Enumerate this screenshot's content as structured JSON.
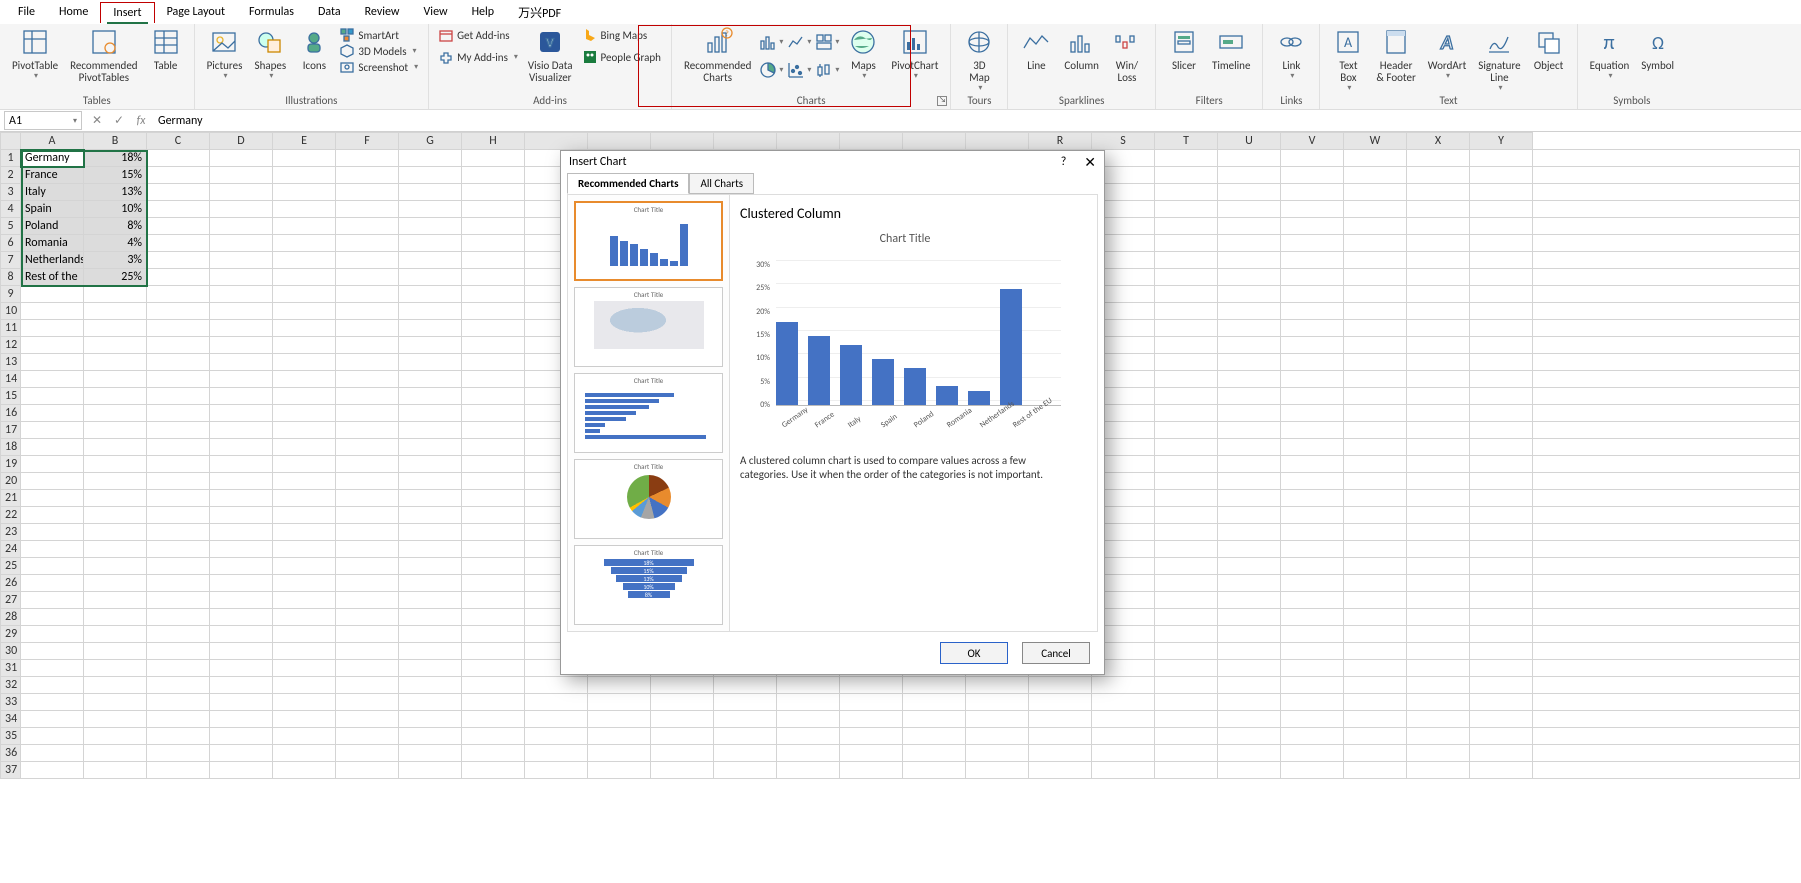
{
  "menu": {
    "tabs": [
      "File",
      "Home",
      "Insert",
      "Page Layout",
      "Formulas",
      "Data",
      "Review",
      "View",
      "Help",
      "万兴PDF"
    ],
    "active": "Insert"
  },
  "ribbon": {
    "tables": {
      "label": "Tables",
      "pivot": "PivotTable",
      "recpivot": "Recommended\nPivotTables",
      "table": "Table"
    },
    "illus": {
      "label": "Illustrations",
      "pictures": "Pictures",
      "shapes": "Shapes",
      "icons": "Icons",
      "smartart": "SmartArt",
      "models": "3D Models",
      "screenshot": "Screenshot"
    },
    "addins": {
      "label": "Add-ins",
      "get": "Get Add-ins",
      "my": "My Add-ins",
      "visio": "Visio Data\nVisualizer",
      "bing": "Bing Maps",
      "people": "People Graph"
    },
    "charts": {
      "label": "Charts",
      "rec": "Recommended\nCharts",
      "maps": "Maps",
      "pivotchart": "PivotChart"
    },
    "tours": {
      "label": "Tours",
      "map3d": "3D\nMap"
    },
    "spark": {
      "label": "Sparklines",
      "line": "Line",
      "column": "Column",
      "winloss": "Win/\nLoss"
    },
    "filters": {
      "label": "Filters",
      "slicer": "Slicer",
      "timeline": "Timeline"
    },
    "links": {
      "label": "Links",
      "link": "Link"
    },
    "text": {
      "label": "Text",
      "textbox": "Text\nBox",
      "header": "Header\n& Footer",
      "wordart": "WordArt",
      "sig": "Signature\nLine",
      "obj": "Object"
    },
    "symbols": {
      "label": "Symbols",
      "eq": "Equation",
      "sym": "Symbol"
    }
  },
  "formula_bar": {
    "cell_ref": "A1",
    "value": "Germany"
  },
  "columns": [
    "A",
    "B",
    "C",
    "D",
    "E",
    "F",
    "G",
    "H",
    "",
    "",
    "",
    "",
    "",
    "",
    "",
    "",
    "",
    "R",
    "S",
    "T",
    "U",
    "V",
    "W",
    "X",
    "Y"
  ],
  "cells": [
    {
      "country": "Germany",
      "pct": "18%"
    },
    {
      "country": "France",
      "pct": "15%"
    },
    {
      "country": "Italy",
      "pct": "13%"
    },
    {
      "country": "Spain",
      "pct": "10%"
    },
    {
      "country": "Poland",
      "pct": "8%"
    },
    {
      "country": "Romania",
      "pct": "4%"
    },
    {
      "country": "Netherlands",
      "pct": "3%"
    },
    {
      "country": "Rest of the",
      "pct": "25%"
    }
  ],
  "dialog": {
    "title": "Insert Chart",
    "tabs": {
      "rec": "Recommended Charts",
      "all": "All Charts"
    },
    "preview_name": "Clustered Column",
    "chart_title": "Chart Title",
    "desc": "A clustered column chart is used to compare values across a few categories. Use it when the order of the categories is not important.",
    "ok": "OK",
    "cancel": "Cancel",
    "help": "?"
  },
  "chart_data": {
    "type": "bar",
    "title": "Chart Title",
    "categories": [
      "Germany",
      "France",
      "Italy",
      "Spain",
      "Poland",
      "Romania",
      "Netherlands",
      "Rest of the EU"
    ],
    "values": [
      18,
      15,
      13,
      10,
      8,
      4,
      3,
      25
    ],
    "yticks": [
      "0%",
      "5%",
      "10%",
      "15%",
      "20%",
      "25%",
      "30%"
    ],
    "ylim": [
      0,
      30
    ],
    "xlabel": "",
    "ylabel": ""
  },
  "thumb_title": "Chart Title"
}
